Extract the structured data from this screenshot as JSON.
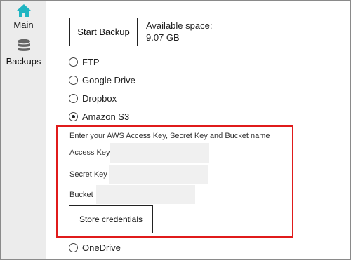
{
  "sidebar": {
    "items": [
      {
        "label": "Main",
        "icon": "home-icon",
        "icon_color": "#1fb5c2"
      },
      {
        "label": "Backups",
        "icon": "database-icon",
        "icon_color": "#666666"
      }
    ]
  },
  "backup": {
    "start_label": "Start Backup",
    "space_label": "Available space:",
    "space_value": "9.07 GB"
  },
  "destinations": [
    {
      "label": "FTP",
      "selected": false
    },
    {
      "label": "Google Drive",
      "selected": false
    },
    {
      "label": "Dropbox",
      "selected": false
    },
    {
      "label": "Amazon S3",
      "selected": true
    },
    {
      "label": "OneDrive",
      "selected": false
    }
  ],
  "s3": {
    "hint": "Enter your AWS Access Key, Secret Key and Bucket name",
    "access_key_label": "Access Key",
    "access_key_value": "",
    "secret_key_label": "Secret Key",
    "secret_key_value": "",
    "bucket_label": "Bucket",
    "bucket_value": "",
    "store_label": "Store credentials"
  },
  "colors": {
    "highlight_border": "#e01b1b",
    "sidebar_bg": "#ececec",
    "field_bg": "#f0f0f0"
  }
}
